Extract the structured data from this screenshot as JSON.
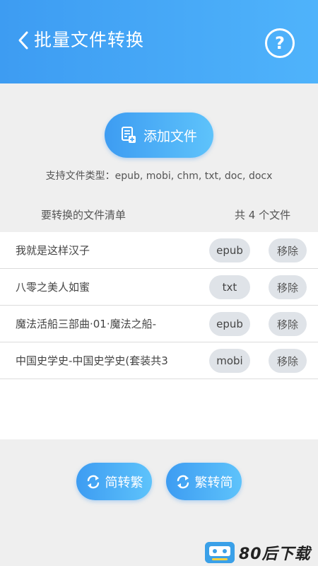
{
  "header": {
    "title": "批量文件转换",
    "help_label": "?"
  },
  "add_button": {
    "label": "添加文件"
  },
  "file_type_note": "支持文件类型：epub, mobi, chm, txt, doc, docx",
  "list_header": {
    "title": "要转换的文件清单",
    "count": "共 4 个文件"
  },
  "files": [
    {
      "name": "我就是这样汉子",
      "type": "epub",
      "remove_label": "移除"
    },
    {
      "name": "八零之美人如蜜",
      "type": "txt",
      "remove_label": "移除"
    },
    {
      "name": "魔法活船三部曲·01·魔法之船-",
      "type": "epub",
      "remove_label": "移除"
    },
    {
      "name": "中国史学史-中国史学史(套装共3",
      "type": "mobi",
      "remove_label": "移除"
    }
  ],
  "convert_buttons": {
    "simple_to_traditional": "简转繁",
    "traditional_to_simple": "繁转简"
  },
  "watermark": {
    "text": "80后下载"
  },
  "colors": {
    "header": "#3d9cf2",
    "accent": "#4fb3fb",
    "background": "#efefef",
    "badge": "#dfe3e8"
  }
}
